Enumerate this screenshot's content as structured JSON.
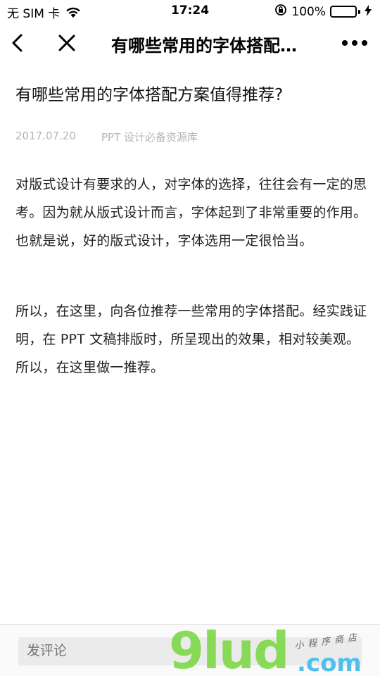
{
  "status_bar": {
    "carrier": "无 SIM 卡",
    "time": "17:24",
    "battery_percent": "100%",
    "battery_level": 1.0,
    "battery_color": "#25c33b",
    "icons": [
      "wifi-icon",
      "orientation-lock-icon",
      "battery-icon",
      "charging-icon"
    ]
  },
  "nav": {
    "title": "有哪些常用的字体搭配方案值得推荐?",
    "icons": [
      "back-icon",
      "close-icon",
      "more-icon"
    ]
  },
  "article": {
    "title": "有哪些常用的字体搭配方案值得推荐?",
    "date": "2017.07.20",
    "source": "PPT 设计必备资源库",
    "paragraphs": [
      "对版式设计有要求的人，对字体的选择，往往会有一定的思考。因为就从版式设计而言，字体起到了非常重要的作用。也就是说，好的版式设计，字体选用一定很恰当。",
      "所以，在这里，向各位推荐一些常用的字体搭配。经实践证明，在 PPT 文稿排版时，所呈现出的效果，相对较美观。所以，在这里做一推荐。"
    ]
  },
  "comment": {
    "placeholder": "发评论"
  },
  "watermark": {
    "main": "9lud",
    "domain": ".com",
    "tagline": "小程序商店"
  }
}
